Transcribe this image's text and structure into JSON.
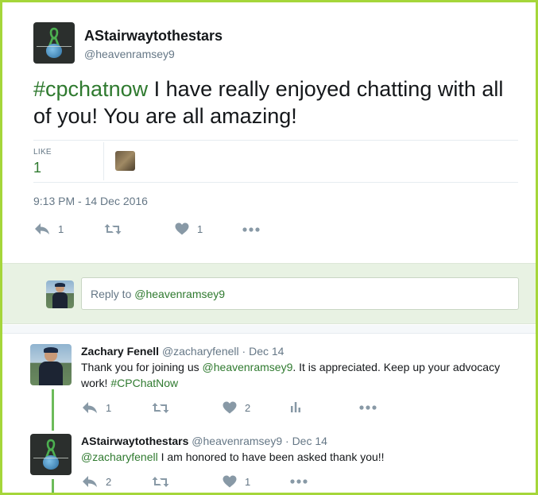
{
  "main_tweet": {
    "author_name": "AStairwaytothestars",
    "author_handle": "@heavenramsey9",
    "text_hashtag": "#cpchatnow",
    "text_body": " I have really enjoyed chatting with all of you! You are all amazing!",
    "likes_label": "LIKE",
    "likes_count": "1",
    "timestamp": "9:13 PM - 14 Dec 2016",
    "actions": {
      "reply_count": "1",
      "retweet_count": "",
      "like_count": "1"
    }
  },
  "reply_box": {
    "prefix": "Reply to ",
    "mention": "@heavenramsey9"
  },
  "replies": [
    {
      "author_name": "Zachary Fenell",
      "author_handle": "@zacharyfenell",
      "separator": "·",
      "date": "Dec 14",
      "text_before": "Thank you for joining us ",
      "text_mention": "@heavenramsey9",
      "text_middle": ". It is appreciated. Keep up your advocacy work! ",
      "text_hashtag": "#CPChatNow",
      "actions": {
        "reply_count": "1",
        "like_count": "2"
      }
    },
    {
      "author_name": "AStairwaytothestars",
      "author_handle": "@heavenramsey9",
      "separator": "·",
      "date": "Dec 14",
      "text_mention": "@zacharyfenell",
      "text_after": " I am honored to have been asked thank you!!",
      "actions": {
        "reply_count": "2",
        "like_count": "1"
      }
    }
  ],
  "colors": {
    "accent": "#2f7a2f",
    "frame": "#a5d63a",
    "thread": "#6cbb5a",
    "icon": "#8899a6"
  },
  "icons": [
    "reply-icon",
    "retweet-icon",
    "heart-icon",
    "more-icon",
    "analytics-icon"
  ]
}
